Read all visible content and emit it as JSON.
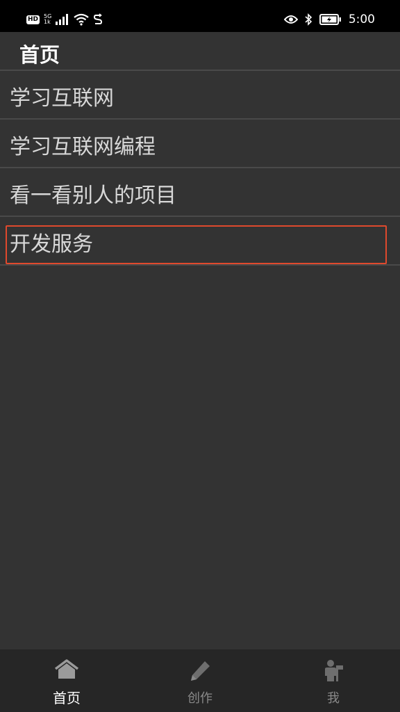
{
  "status_bar": {
    "hd": "HD",
    "network_top": "5G",
    "network_bottom": "1k",
    "time": "5:00"
  },
  "header": {
    "title": "首页"
  },
  "list": {
    "items": [
      {
        "label": "学习互联网"
      },
      {
        "label": "学习互联网编程"
      },
      {
        "label": "看一看别人的项目"
      },
      {
        "label": "开发服务"
      }
    ]
  },
  "bottom_nav": {
    "items": [
      {
        "label": "首页",
        "icon": "home-icon"
      },
      {
        "label": "创作",
        "icon": "pencil-icon"
      },
      {
        "label": "我",
        "icon": "person-icon"
      }
    ]
  },
  "colors": {
    "background": "#333333",
    "nav_background": "#262626",
    "highlight_border": "#e0492d"
  }
}
